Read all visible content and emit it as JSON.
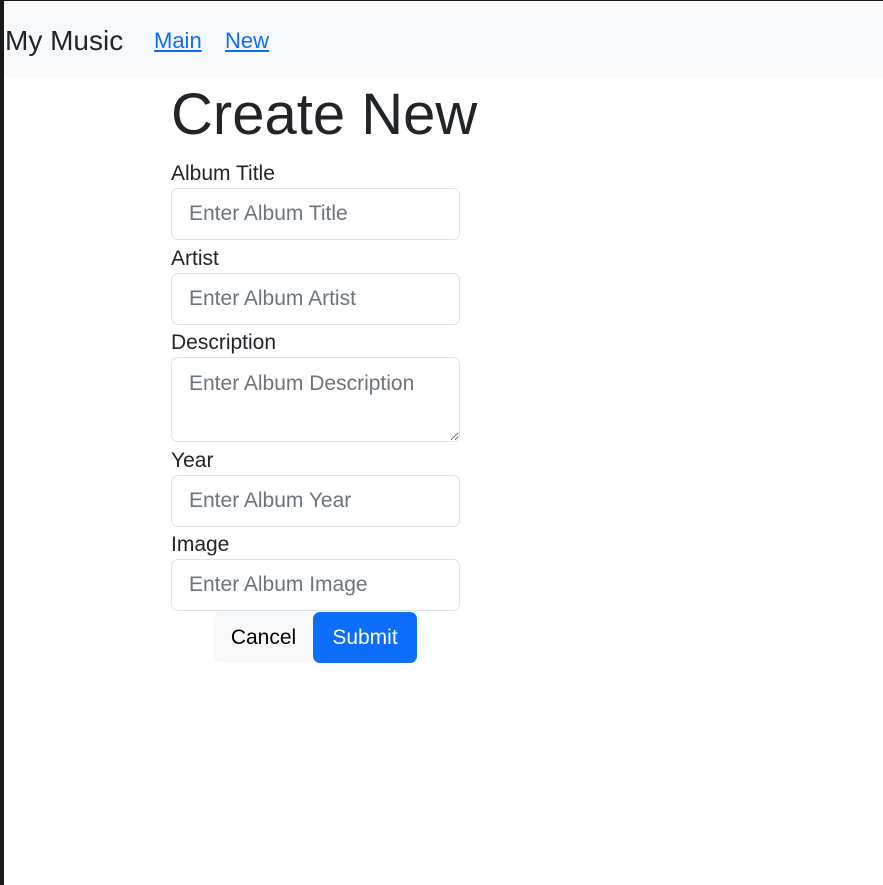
{
  "navbar": {
    "brand": "My Music",
    "links": [
      {
        "label": "Main"
      },
      {
        "label": "New"
      }
    ]
  },
  "page": {
    "title": "Create New"
  },
  "form": {
    "fields": [
      {
        "label": "Album Title",
        "placeholder": "Enter Album Title",
        "value": ""
      },
      {
        "label": "Artist",
        "placeholder": "Enter Album Artist",
        "value": ""
      },
      {
        "label": "Description",
        "placeholder": "Enter Album Description",
        "value": ""
      },
      {
        "label": "Year",
        "placeholder": "Enter Album Year",
        "value": ""
      },
      {
        "label": "Image",
        "placeholder": "Enter Album Image",
        "value": ""
      }
    ],
    "cancel_label": "Cancel",
    "submit_label": "Submit"
  },
  "colors": {
    "link": "#0d6efd",
    "primary_button": "#0d6efd",
    "navbar_background": "#f8f9fa",
    "text": "#212529"
  }
}
